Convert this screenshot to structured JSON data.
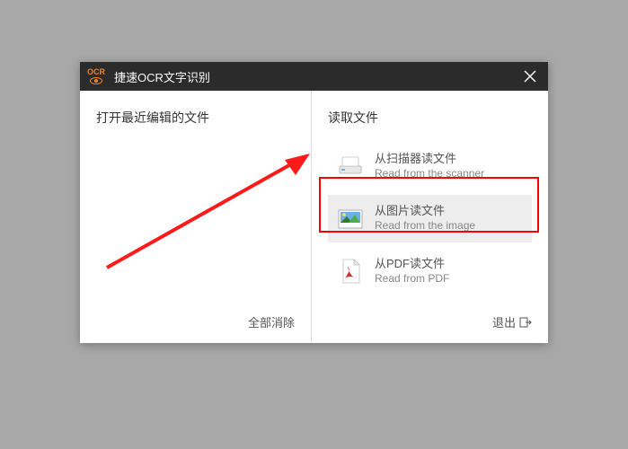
{
  "titlebar": {
    "logo_text": "OCR",
    "title": "捷速OCR文字识别"
  },
  "left": {
    "title": "打开最近编辑的文件",
    "clear_all": "全部消除"
  },
  "right": {
    "title": "读取文件",
    "options": [
      {
        "title": "从扫描器读文件",
        "subtitle": "Read from the scanner"
      },
      {
        "title": "从图片读文件",
        "subtitle": "Read from the image"
      },
      {
        "title": "从PDF读文件",
        "subtitle": "Read from PDF"
      }
    ],
    "exit": "退出"
  }
}
